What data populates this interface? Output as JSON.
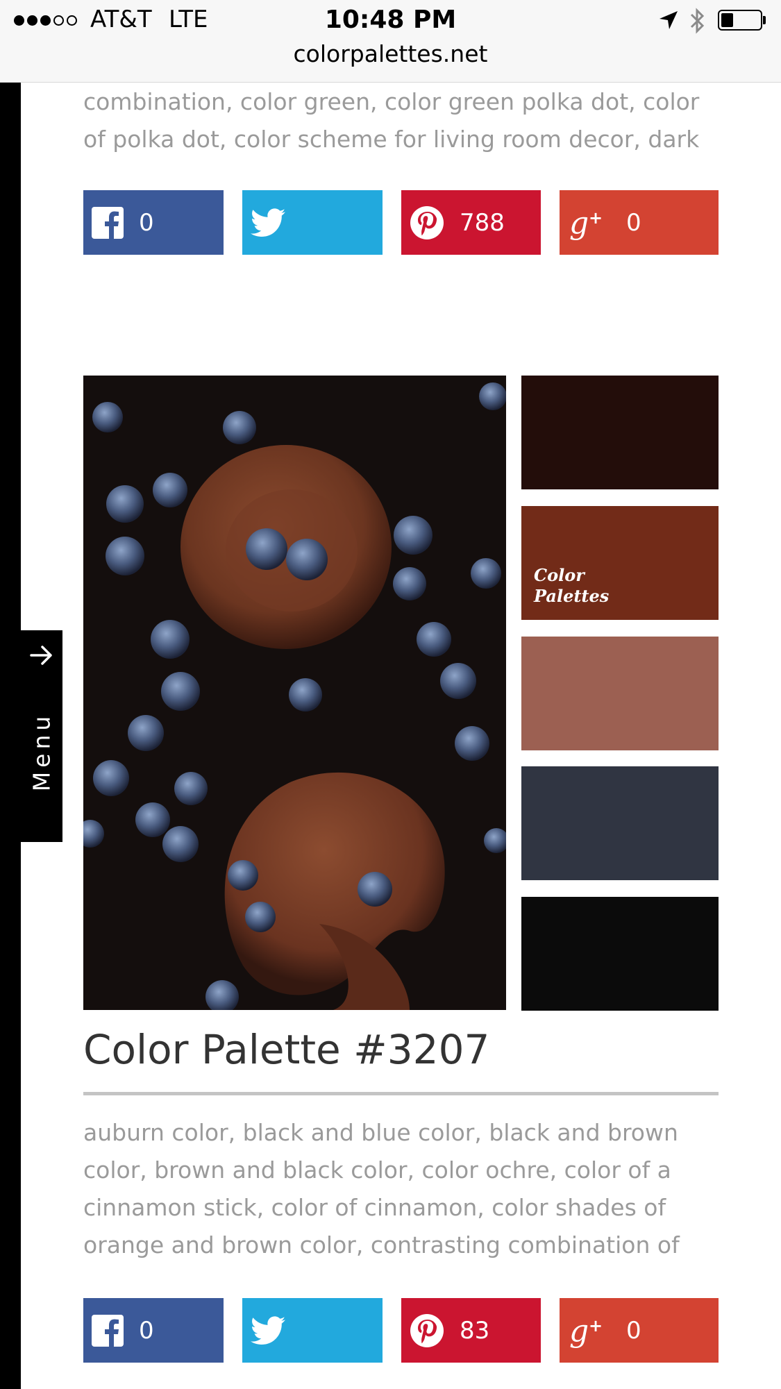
{
  "status_bar": {
    "carrier": "AT&T",
    "network": "LTE",
    "time": "10:48 PM"
  },
  "browser": {
    "url": "colorpalettes.net"
  },
  "side_menu": {
    "label": "Menu"
  },
  "previous_palette": {
    "tags": "combination, color green, color green polka dot, color of polka dot, color scheme for living room decor, dark blue",
    "share": {
      "facebook": "0",
      "pinterest": "788",
      "googleplus": "0"
    }
  },
  "palette": {
    "title": "Color Palette #3207",
    "swatches": [
      "#230d0a",
      "#722b18",
      "#9c6052",
      "#303542",
      "#0b0b0b"
    ],
    "logo_line1": "Color",
    "logo_line2": "Palettes",
    "tags": "auburn color, black and blue color, black and brown color, brown and black color, color ochre, color of a cinnamon stick, color of cinnamon, color shades of orange and brown color, contrasting combination of",
    "share": {
      "facebook": "0",
      "pinterest": "83",
      "googleplus": "0"
    }
  },
  "colors": {
    "facebook": "#3b5999",
    "twitter": "#22a9dd",
    "pinterest": "#cb1530",
    "googleplus": "#d34332"
  },
  "icons": {
    "facebook": "facebook-icon",
    "twitter": "twitter-icon",
    "pinterest": "pinterest-icon",
    "googleplus": "googleplus-icon",
    "menu_arrow": "arrow-right-icon"
  }
}
